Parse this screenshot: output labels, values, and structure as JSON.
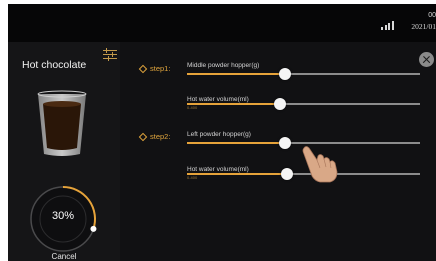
{
  "status": {
    "time": "00",
    "date": "2021/01",
    "signal_icon": "signal-bars-icon"
  },
  "left": {
    "drink_name": "Hot chocolate",
    "menu_icon": "sliders-icon",
    "cup_icon": "cup-icon",
    "progress": {
      "percent_label": "30%",
      "value": 0.3
    },
    "cancel_label": "Cancel"
  },
  "main": {
    "close_icon": "close-icon",
    "steps": [
      {
        "label": "step1:",
        "params": [
          {
            "label": "Middle powder hopper(g)",
            "sub": "",
            "value": 0.42
          },
          {
            "label": "Hot water volume(ml)",
            "sub": "0-400",
            "value": 0.4
          }
        ]
      },
      {
        "label": "step2:",
        "params": [
          {
            "label": "Left powder hopper(g)",
            "sub": "",
            "value": 0.42
          },
          {
            "label": "Hot water volume(ml)",
            "sub": "0-400",
            "value": 0.43
          }
        ]
      }
    ]
  },
  "colors": {
    "accent": "#e6a33a",
    "background": "#0b0b0d",
    "panel": "#151517"
  }
}
